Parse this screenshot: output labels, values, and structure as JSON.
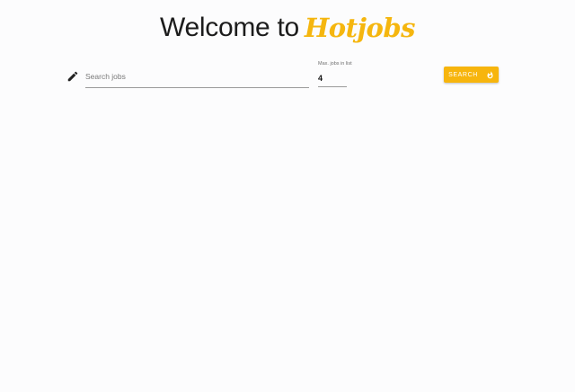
{
  "header": {
    "welcome_text": "Welcome to",
    "brand_text": "Hotjobs"
  },
  "search": {
    "placeholder": "Search jobs",
    "value": ""
  },
  "max_jobs": {
    "label": "Max. jobs in list",
    "value": "4"
  },
  "search_button": {
    "label": "SEARCH",
    "icon": "flame-icon"
  },
  "icons": {
    "edit": "pencil-icon"
  },
  "colors": {
    "brand": "#f5b60f",
    "button": "#f7b50d",
    "background": "#fcfcfd"
  }
}
